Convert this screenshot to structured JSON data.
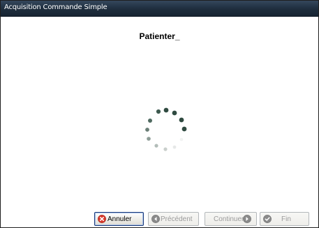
{
  "window": {
    "title": "Acquisition Commande Simple"
  },
  "main": {
    "status_message": "Patienter_"
  },
  "spinner": {
    "icon": "loading-spinner-icon",
    "colors": {
      "dark": "#2f4a40",
      "mid": "#6f8178",
      "light": "#c9cfcc"
    }
  },
  "buttons": {
    "cancel_label": "Annuler",
    "previous_label": "Précédent",
    "continue_label": "Continuer",
    "finish_label": "Fin"
  },
  "colors": {
    "titlebar": "#1e2d3d",
    "cancel_icon": "#d9382b",
    "disabled_icon": "#8a8a8a"
  }
}
